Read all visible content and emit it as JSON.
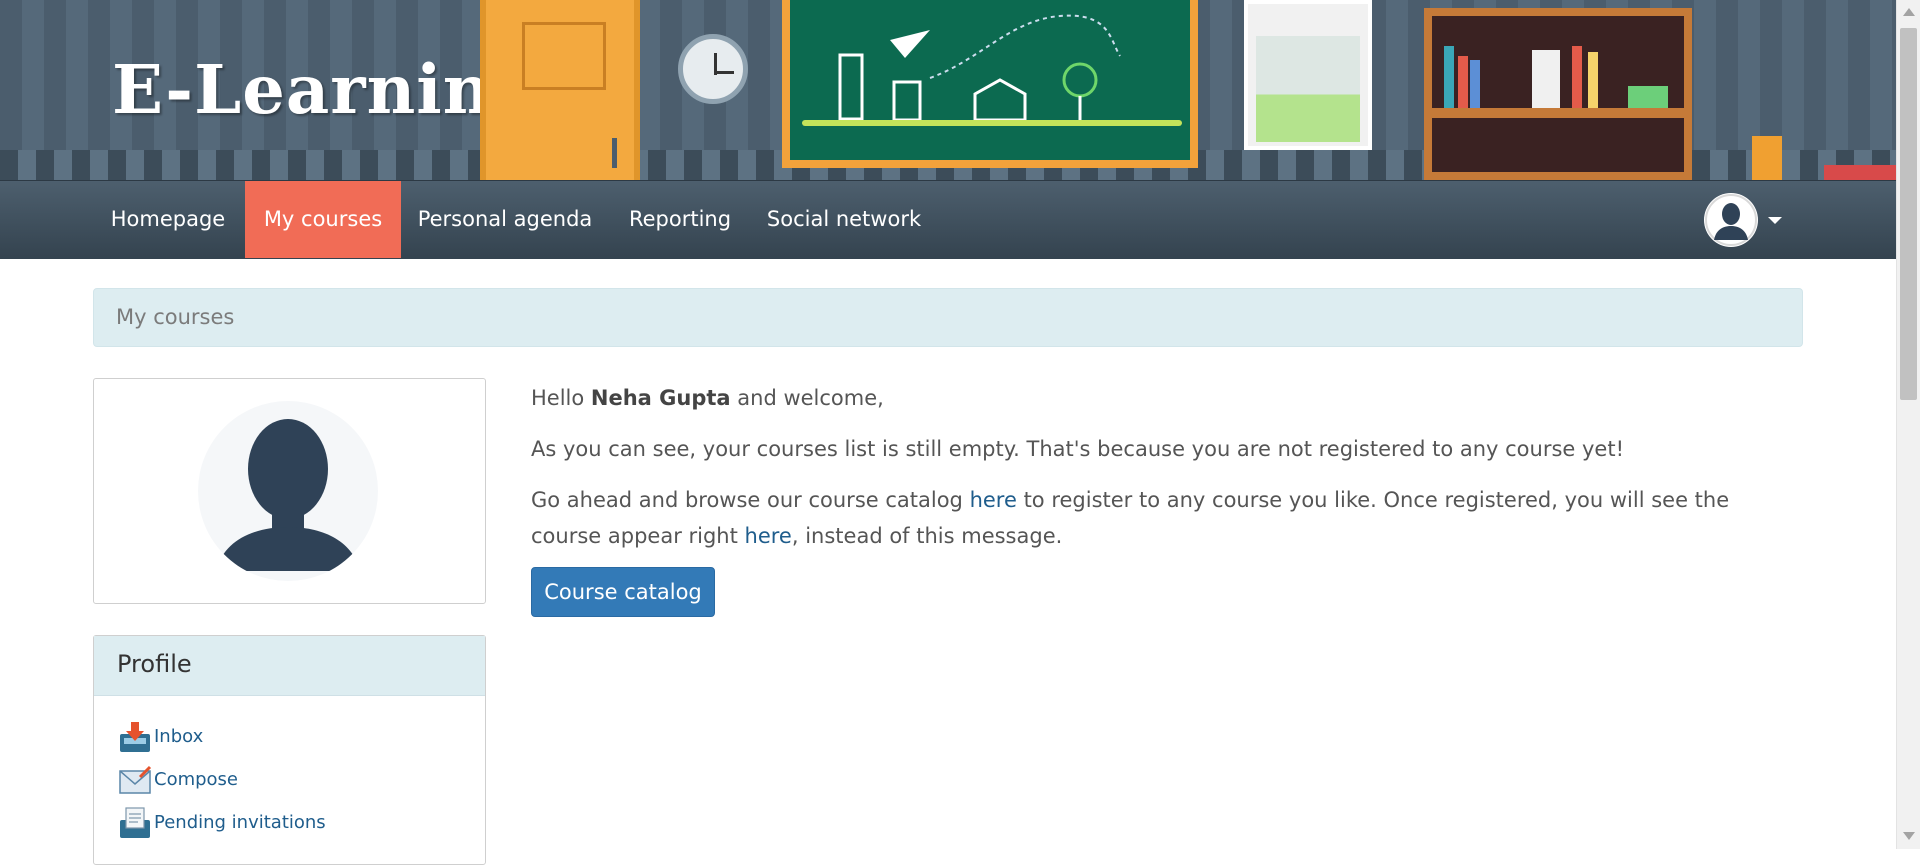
{
  "banner": {
    "logo": "E-Learning"
  },
  "nav": {
    "items": [
      {
        "label": "Homepage",
        "active": false
      },
      {
        "label": "My courses",
        "active": true
      },
      {
        "label": "Personal agenda",
        "active": false
      },
      {
        "label": "Reporting",
        "active": false
      },
      {
        "label": "Social network",
        "active": false
      }
    ],
    "active_color": "#f16c56"
  },
  "breadcrumb": {
    "label": "My courses"
  },
  "main": {
    "greeting_prefix": "Hello ",
    "user_name": "Neha Gupta",
    "greeting_suffix": " and welcome,",
    "empty_message": "As you can see, your courses list is still empty. That's because you are not registered to any course yet!",
    "browse_prefix": "Go ahead and browse our course catalog ",
    "link_here_1": "here",
    "browse_middle": " to register to any course you like. Once registered, you will see the course appear right ",
    "link_here_2": "here",
    "browse_suffix": ", instead of this message.",
    "catalog_button": "Course catalog"
  },
  "profile": {
    "title": "Profile",
    "items": [
      {
        "label": "Inbox",
        "icon": "inbox-icon"
      },
      {
        "label": "Compose",
        "icon": "compose-icon"
      },
      {
        "label": "Pending invitations",
        "icon": "invitations-icon"
      }
    ]
  },
  "colors": {
    "nav_bg": "#3d4d5a",
    "panel_bg": "#ddedf1",
    "button_bg": "#337ab7",
    "link": "#1f5d8c"
  }
}
